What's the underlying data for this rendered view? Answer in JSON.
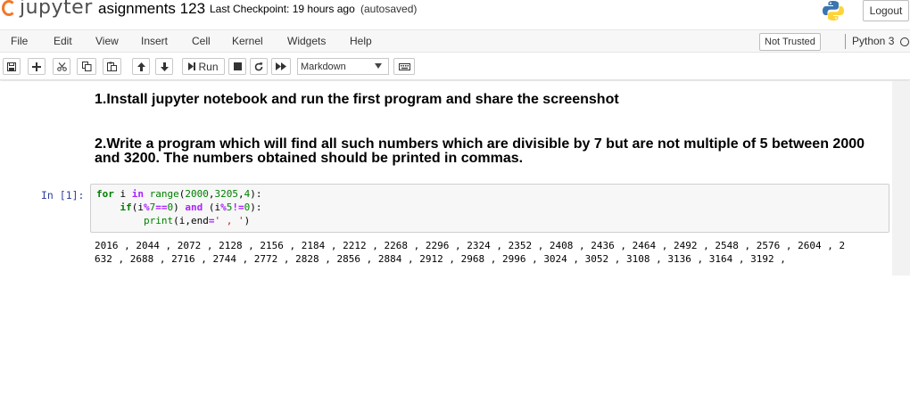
{
  "header": {
    "logo_text": "jupyter",
    "notebook_title": "asignments 123",
    "checkpoint": "Last Checkpoint: 19 hours ago",
    "autosave_status": "(autosaved)",
    "logout_label": "Logout",
    "python_logo_icon": "python-logo-icon",
    "brand_color": "#f37726"
  },
  "menubar": {
    "items": [
      "File",
      "Edit",
      "View",
      "Insert",
      "Cell",
      "Kernel",
      "Widgets",
      "Help"
    ],
    "trust_status": "Not Trusted",
    "kernel_name": "Python 3",
    "kernel_indicator_icon": "kernel-idle-circle-icon"
  },
  "toolbar": {
    "buttons": [
      {
        "name": "save-button",
        "icon": "floppy-icon"
      },
      {
        "name": "insert-cell-below-button",
        "icon": "plus-icon"
      },
      {
        "name": "cut-cells-button",
        "icon": "scissors-icon"
      },
      {
        "name": "copy-cells-button",
        "icon": "copy-icon"
      },
      {
        "name": "paste-cells-button",
        "icon": "paste-icon"
      },
      {
        "name": "move-up-button",
        "icon": "arrow-up-icon"
      },
      {
        "name": "move-down-button",
        "icon": "arrow-down-icon"
      },
      {
        "name": "run-button",
        "icon": "step-forward-icon"
      },
      {
        "name": "interrupt-button",
        "icon": "stop-icon"
      },
      {
        "name": "restart-button",
        "icon": "restart-icon"
      },
      {
        "name": "restart-run-all-button",
        "icon": "fast-forward-icon"
      },
      {
        "name": "command-palette-button",
        "icon": "keyboard-icon"
      }
    ],
    "run_label": "Run",
    "cell_type": "Markdown"
  },
  "cells": {
    "markdown_1": "1.Install jupyter notebook and run the first program and share the screenshot",
    "markdown_2": "2.Write a program which will find all such numbers which are divisible by 7 but are not multiple of 5 between 2000 and 3200. The numbers obtained should be printed in commas.",
    "code_prompt": "In [1]:",
    "code_lines": [
      "for i in range(2000,3205,4):",
      "    if(i%7==0) and (i%5!=0):",
      "        print(i,end=' , ')"
    ],
    "output_lines": [
      "2016 , 2044 , 2072 , 2128 , 2156 , 2184 , 2212 , 2268 , 2296 , 2324 , 2352 , 2408 , 2436 , 2464 , 2492 , 2548 , 2576 , 2604 , 2",
      "632 , 2688 , 2716 , 2744 , 2772 , 2828 , 2856 , 2884 , 2912 , 2968 , 2996 , 3024 , 3052 , 3108 , 3136 , 3164 , 3192 ,"
    ]
  }
}
